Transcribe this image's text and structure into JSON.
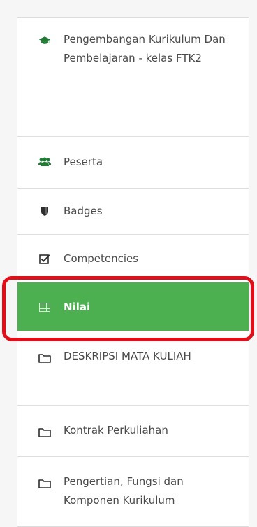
{
  "nav": {
    "items": [
      {
        "label": "Pengembangan Kurikulum Dan Pembelajaran - kelas FTK2",
        "icon": "graduation-cap-icon"
      },
      {
        "label": "Peserta",
        "icon": "users-icon"
      },
      {
        "label": "Badges",
        "icon": "shield-icon"
      },
      {
        "label": "Competencies",
        "icon": "checkbox-icon"
      },
      {
        "label": "Nilai",
        "icon": "table-icon"
      },
      {
        "label": "DESKRIPSI MATA KULIAH",
        "icon": "folder-icon"
      },
      {
        "label": "Kontrak Perkuliahan",
        "icon": "folder-icon"
      },
      {
        "label": "Pengertian, Fungsi dan Komponen Kurikulum",
        "icon": "folder-icon"
      }
    ],
    "active_index": 4
  },
  "colors": {
    "active_bg": "#4caf50",
    "highlight": "#e0101a",
    "icon": "#2e2e2e"
  }
}
